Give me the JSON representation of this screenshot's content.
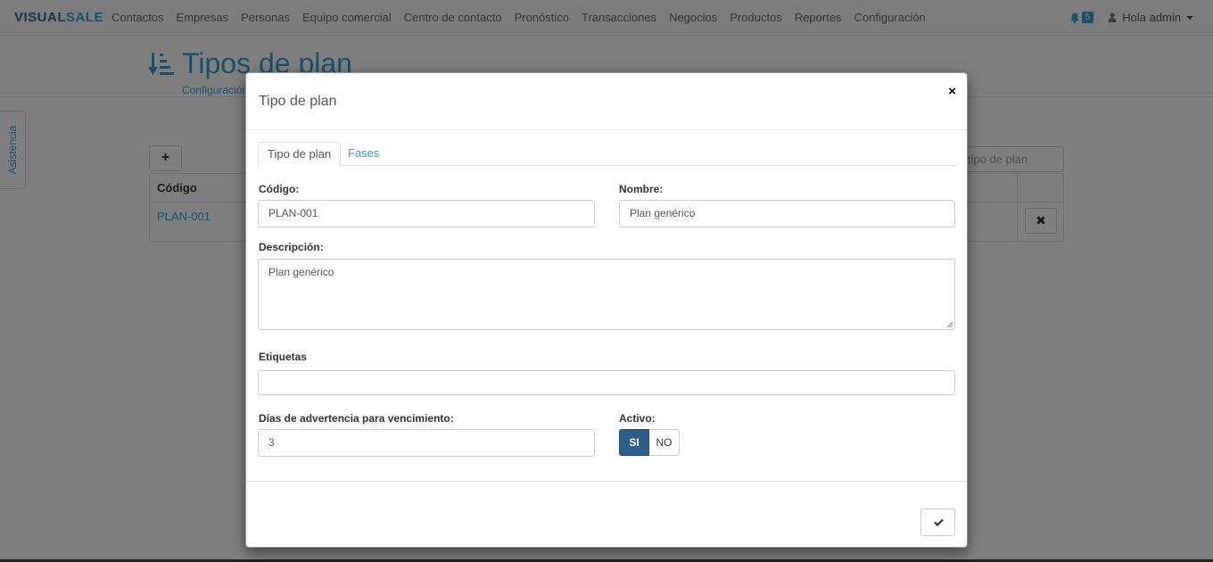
{
  "navbar": {
    "brand_part1": "VISUAL",
    "brand_part2": "SALE",
    "links": [
      "Contactos",
      "Empresas",
      "Personas",
      "Equipo comercial",
      "Centro de contacto",
      "Pronóstico",
      "Transacciones",
      "Negocios",
      "Productos",
      "Reportes",
      "Configuración"
    ],
    "notification_count": "5",
    "user_label": "Hola admin",
    "icons": {
      "notifications": "bell-icon",
      "user": "user-icon",
      "menu": "caret-down-icon"
    }
  },
  "page": {
    "title": "Tipos de plan",
    "breadcrumb": "Configuración",
    "side_tab": "Asistencia",
    "add_label": "+",
    "search_placeholder": "tipo de plan",
    "table": {
      "headers": [
        "Código"
      ],
      "rows": [
        {
          "code": "PLAN-001",
          "delete_label": "✖"
        }
      ]
    }
  },
  "modal": {
    "title": "Tipo de plan",
    "close_label": "×",
    "tabs": [
      "Tipo de plan",
      "Fases"
    ],
    "active_tab": "Tipo de plan",
    "form": {
      "codigo_label": "Código:",
      "codigo_value": "PLAN-001",
      "nombre_label": "Nombre:",
      "nombre_value": "Plan genérico",
      "descripcion_label": "Descripción:",
      "descripcion_value": "Plan genérico",
      "etiquetas_label": "Etiquetas",
      "etiquetas_value": "",
      "dias_label": "Días de advertencia para vencimiento:",
      "dias_value": "3",
      "activo_label": "Activo:",
      "activo_si": "SI",
      "activo_no": "NO",
      "activo_selected": "SI"
    },
    "footer": {
      "confirm_icon": "check-icon"
    }
  },
  "colors": {
    "accent": "#2aa3d6",
    "toggle_active": "#2b5f8c",
    "badge": "#3aa0d2"
  }
}
